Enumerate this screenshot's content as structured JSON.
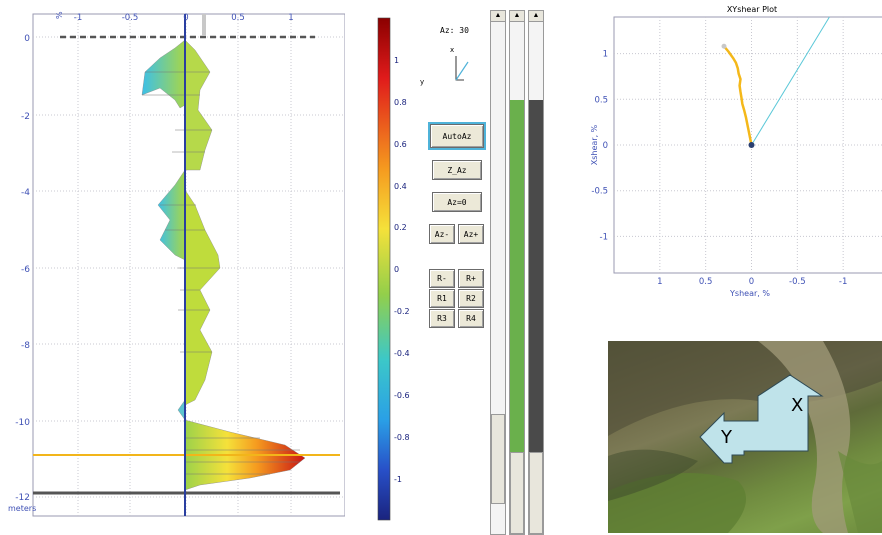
{
  "profile": {
    "x_ticks": [
      "-1",
      "-0.5",
      "0",
      "0.5",
      "1"
    ],
    "y_ticks": [
      "0",
      "-2",
      "-4",
      "-6",
      "-8",
      "-10",
      "-12"
    ],
    "y_unit": "meters",
    "x_unit": "%"
  },
  "colorbar": {
    "ticks": [
      "1",
      "0.8",
      "0.6",
      "0.4",
      "0.2",
      "0",
      "-0.2",
      "-0.4",
      "-0.6",
      "-0.8",
      "-1"
    ]
  },
  "controls": {
    "azimuth_readout": "Az: 30",
    "axis_x": "x",
    "axis_y": "y",
    "buttons": {
      "autoaz": "AutoAz",
      "z_az": "Z_Az",
      "az0": "Az=0",
      "az_minus": "Az-",
      "az_plus": "Az+",
      "r_minus": "R-",
      "r_plus": "R+",
      "r1": "R1",
      "r2": "R2",
      "r3": "R3",
      "r4": "R4"
    }
  },
  "sliders": {
    "white": {
      "level": 0.18,
      "color": "#f4f4f4"
    },
    "green": {
      "level": 0.83,
      "color": "#6ab04c"
    },
    "dark": {
      "level": 0.83,
      "color": "#4a4a4a"
    }
  },
  "chart_data": {
    "type": "scatter",
    "title": "XYshear Plot",
    "xlabel": "Yshear, %",
    "ylabel": "Xshear, %",
    "x_ticks": [
      "1",
      "0.5",
      "0",
      "-0.5",
      "-1"
    ],
    "y_ticks": [
      "1",
      "0.5",
      "0",
      "-0.5",
      "-1"
    ],
    "xlim": [
      1.5,
      -1.5
    ],
    "ylim": [
      -1.4,
      1.4
    ],
    "grid": true,
    "series": [
      {
        "color": "#f4b81a",
        "x": [
          0.0,
          0.02,
          0.04,
          0.06,
          0.08,
          0.1,
          0.11,
          0.12,
          0.13,
          0.12,
          0.14,
          0.15,
          0.17,
          0.2,
          0.25,
          0.3
        ],
        "y": [
          0.0,
          0.1,
          0.2,
          0.3,
          0.38,
          0.45,
          0.52,
          0.58,
          0.65,
          0.72,
          0.78,
          0.84,
          0.9,
          0.95,
          1.02,
          1.08
        ]
      }
    ],
    "reference_line": {
      "color": "#5bc8d8",
      "x": [
        0.0,
        -0.85
      ],
      "y": [
        0.0,
        1.45
      ]
    }
  },
  "photo": {
    "arrow_x_label": "X",
    "arrow_y_label": "Y",
    "arrow_color": "#bfe3ea"
  }
}
